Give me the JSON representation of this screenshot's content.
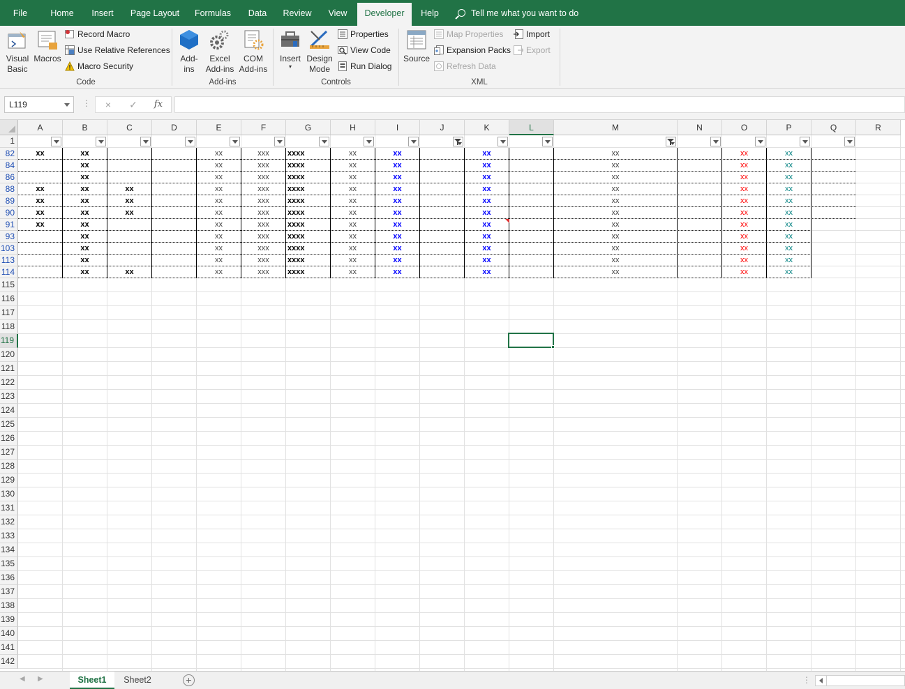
{
  "menu": {
    "tabs": [
      "File",
      "Home",
      "Insert",
      "Page Layout",
      "Formulas",
      "Data",
      "Review",
      "View",
      "Developer",
      "Help"
    ],
    "active": "Developer",
    "tell_me": "Tell me what you want to do"
  },
  "ribbon": {
    "code": {
      "label": "Code",
      "visual_basic": [
        "Visual",
        "Basic"
      ],
      "macros": "Macros",
      "record_macro": "Record Macro",
      "use_relative": "Use Relative References",
      "macro_security": "Macro Security"
    },
    "addins": {
      "label": "Add-ins",
      "addins": [
        "Add-",
        "ins"
      ],
      "excel_addins": [
        "Excel",
        "Add-ins"
      ],
      "com_addins": [
        "COM",
        "Add-ins"
      ]
    },
    "controls": {
      "label": "Controls",
      "insert": "Insert",
      "design_mode": [
        "Design",
        "Mode"
      ],
      "properties": "Properties",
      "view_code": "View Code",
      "run_dialog": "Run Dialog"
    },
    "xml": {
      "label": "XML",
      "source": "Source",
      "map_properties": "Map Properties",
      "expansion_packs": "Expansion Packs",
      "refresh_data": "Refresh Data",
      "import": "Import",
      "export": "Export"
    }
  },
  "formula_bar": {
    "name_box": "L119",
    "cancel_icon": "×",
    "enter_icon": "✓",
    "fx_label": "fx",
    "formula": ""
  },
  "columns": [
    "A",
    "B",
    "C",
    "D",
    "E",
    "F",
    "G",
    "H",
    "I",
    "J",
    "K",
    "L",
    "M",
    "N",
    "O",
    "P",
    "Q",
    "R"
  ],
  "selected_column": "L",
  "filtered_columns": [
    "J",
    "M"
  ],
  "data_rows": [
    {
      "row": "82",
      "A": "xx",
      "B": "xx",
      "C": "",
      "E": "xx",
      "F": "xxx",
      "G": "xxxx",
      "H": "xx",
      "I": "xx",
      "K": "xx",
      "M": "xx",
      "O": "xx",
      "P": "xx"
    },
    {
      "row": "84",
      "A": "",
      "B": "xx",
      "C": "",
      "E": "xx",
      "F": "xxx",
      "G": "xxxx",
      "H": "xx",
      "I": "xx",
      "K": "xx",
      "M": "xx",
      "O": "xx",
      "P": "xx"
    },
    {
      "row": "86",
      "A": "",
      "B": "xx",
      "C": "",
      "E": "xx",
      "F": "xxx",
      "G": "xxxx",
      "H": "xx",
      "I": "xx",
      "K": "xx",
      "M": "xx",
      "O": "xx",
      "P": "xx"
    },
    {
      "row": "88",
      "A": "xx",
      "B": "xx",
      "C": "xx",
      "E": "xx",
      "F": "xxx",
      "G": "xxxx",
      "H": "xx",
      "I": "xx",
      "K": "xx",
      "M": "xx",
      "O": "xx",
      "P": "xx"
    },
    {
      "row": "89",
      "A": "xx",
      "B": "xx",
      "C": "xx",
      "E": "xx",
      "F": "xxx",
      "G": "xxxx",
      "H": "xx",
      "I": "xx",
      "K": "xx",
      "M": "xx",
      "O": "xx",
      "P": "xx"
    },
    {
      "row": "90",
      "A": "xx",
      "B": "xx",
      "C": "xx",
      "E": "xx",
      "F": "xxx",
      "G": "xxxx",
      "H": "xx",
      "I": "xx",
      "K": "xx",
      "M": "xx",
      "O": "xx",
      "P": "xx"
    },
    {
      "row": "91",
      "A": "xx",
      "B": "xx",
      "C": "",
      "E": "xx",
      "F": "xxx",
      "G": "xxxx",
      "H": "xx",
      "I": "xx",
      "K": "xx",
      "M": "xx",
      "O": "xx",
      "P": "xx"
    },
    {
      "row": "93",
      "A": "",
      "B": "xx",
      "C": "",
      "E": "xx",
      "F": "xxx",
      "G": "xxxx",
      "H": "xx",
      "I": "xx",
      "K": "xx",
      "M": "xx",
      "O": "xx",
      "P": "xx"
    },
    {
      "row": "103",
      "A": "",
      "B": "xx",
      "C": "",
      "E": "xx",
      "F": "xxx",
      "G": "xxxx",
      "H": "xx",
      "I": "xx",
      "K": "xx",
      "M": "xx",
      "O": "xx",
      "P": "xx"
    },
    {
      "row": "113",
      "A": "",
      "B": "xx",
      "C": "",
      "E": "xx",
      "F": "xxx",
      "G": "xxxx",
      "H": "xx",
      "I": "xx",
      "K": "xx",
      "M": "xx",
      "O": "xx",
      "P": "xx"
    },
    {
      "row": "114",
      "A": "",
      "B": "xx",
      "C": "xx",
      "E": "xx",
      "F": "xxx",
      "G": "xxxx",
      "H": "xx",
      "I": "xx",
      "K": "xx",
      "M": "xx",
      "O": "xx",
      "P": "xx"
    }
  ],
  "empty_rows": [
    "115",
    "116",
    "117",
    "118",
    "119",
    "120",
    "121",
    "122",
    "123",
    "124",
    "125",
    "126",
    "127",
    "128",
    "129",
    "130",
    "131",
    "132",
    "133",
    "134",
    "135",
    "136",
    "137",
    "138",
    "139",
    "140",
    "141",
    "142"
  ],
  "header_row": "1",
  "selected_row": "119",
  "colors": {
    "accent": "#217346",
    "blue_text": "#0000ff",
    "red_text": "#ff0000",
    "teal_text": "#008080",
    "filtered_row_number": "#1f4eb4"
  },
  "sheets": [
    "Sheet1",
    "Sheet2"
  ],
  "active_sheet": "Sheet1"
}
